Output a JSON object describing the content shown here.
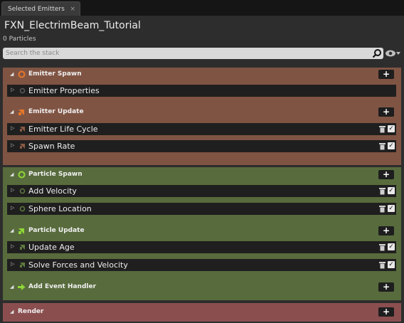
{
  "tab": {
    "label": "Selected Emitters",
    "close": "×"
  },
  "header": {
    "title": "FXN_ElectrimBeam_Tutorial",
    "subtitle": "0 Particles"
  },
  "search": {
    "placeholder": "Search the stack"
  },
  "colors": {
    "emitter_group": "#805443",
    "particle_group": "#586b3d",
    "render_group": "#8b4e4f",
    "emitter_icon": "#e5782a",
    "particle_icon": "#8ed836"
  },
  "emitter": {
    "spawn": {
      "label": "Emitter Spawn",
      "items": [
        {
          "label": "Emitter Properties"
        }
      ]
    },
    "update": {
      "label": "Emitter Update",
      "items": [
        {
          "label": "Emitter Life Cycle"
        },
        {
          "label": "Spawn Rate"
        }
      ]
    }
  },
  "particle": {
    "spawn": {
      "label": "Particle Spawn",
      "items": [
        {
          "label": "Add Velocity"
        },
        {
          "label": "Sphere Location"
        }
      ]
    },
    "update": {
      "label": "Particle Update",
      "items": [
        {
          "label": "Update Age"
        },
        {
          "label": "Solve Forces and Velocity"
        }
      ]
    },
    "event": {
      "label": "Add Event Handler"
    }
  },
  "render": {
    "label": "Render"
  },
  "glyphs": {
    "plus": "+",
    "check": "✓",
    "collapse": "◢",
    "expand": "▷"
  }
}
